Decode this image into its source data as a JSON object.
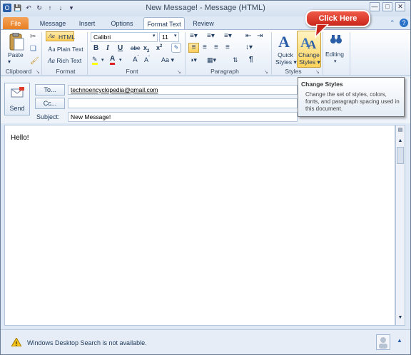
{
  "window": {
    "title": "New Message! - Message (HTML)"
  },
  "tabs": [
    {
      "label": "File"
    },
    {
      "label": "Message"
    },
    {
      "label": "Insert"
    },
    {
      "label": "Options"
    },
    {
      "label": "Format Text"
    },
    {
      "label": "Review"
    }
  ],
  "ribbon": {
    "clipboard": {
      "label": "Clipboard",
      "paste": "Paste"
    },
    "format": {
      "label": "Format",
      "html": "HTML",
      "plain_text": "Plain Text",
      "rich_text": "Rich Text",
      "aa": "Aa"
    },
    "font": {
      "label": "Font",
      "font_name": "Calibri",
      "font_size": "11"
    },
    "paragraph": {
      "label": "Paragraph"
    },
    "styles": {
      "label": "Styles",
      "quick_styles_1": "Quick",
      "quick_styles_2": "Styles",
      "change_styles_1": "Change",
      "change_styles_2": "Styles"
    },
    "editing": {
      "label": "Editing"
    }
  },
  "callout": {
    "text": "Click Here"
  },
  "tooltip": {
    "title": "Change Styles",
    "body": "Change the set of styles, colors, fonts, and paragraph spacing used in this document."
  },
  "header": {
    "send": "Send",
    "to_button": "To...",
    "cc_button": "Cc...",
    "subject_label": "Subject:",
    "to_value": "technoencyclopedia@gmail.com",
    "cc_value": "",
    "subject_value": "New Message!"
  },
  "body": {
    "text": "Hello!"
  },
  "status": {
    "text": "Windows Desktop Search is not available."
  },
  "colors": {
    "accent": "#e87c1e",
    "callout": "#d9342a",
    "ribbon": "#dfe9f5"
  }
}
